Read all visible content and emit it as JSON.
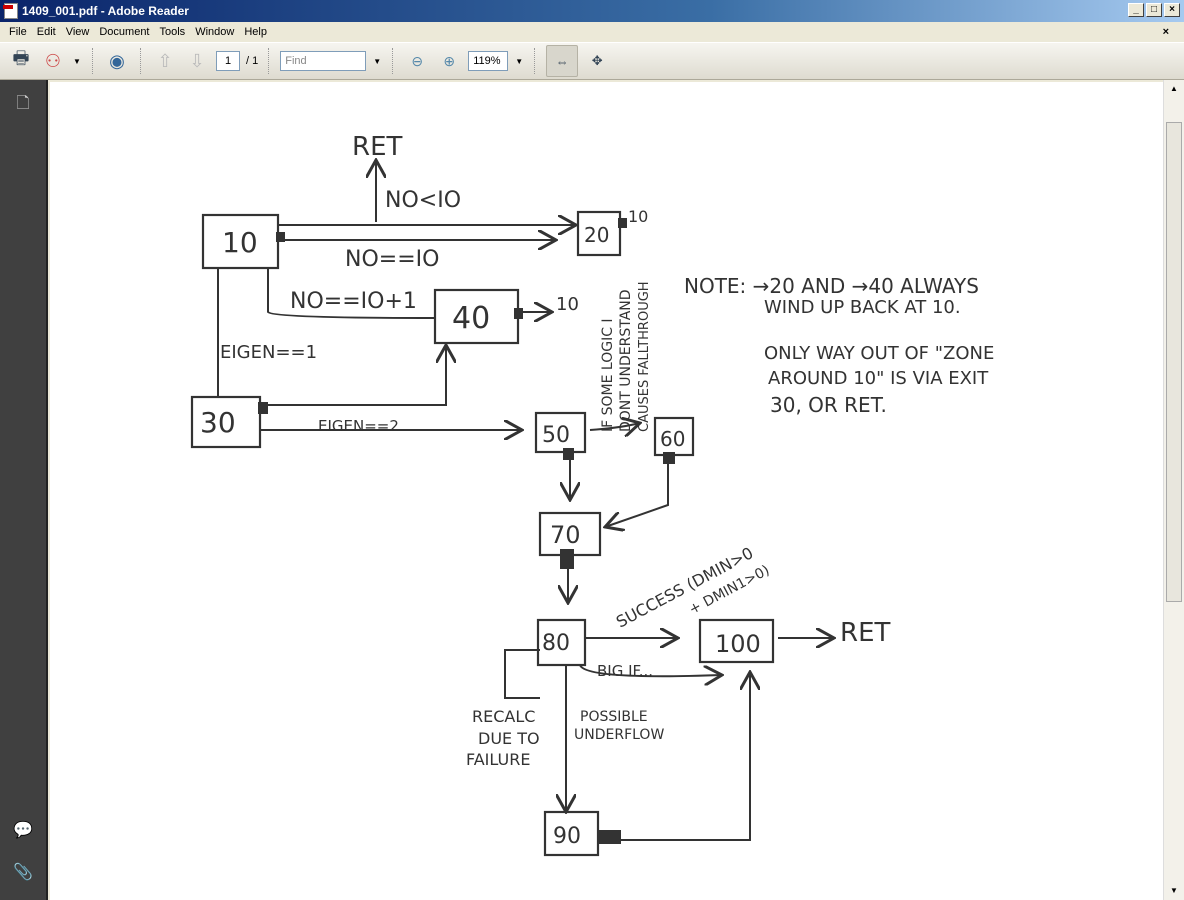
{
  "window": {
    "title": "1409_001.pdf - Adobe Reader",
    "controls": [
      "_",
      "□",
      "×"
    ]
  },
  "menu": {
    "items": [
      "File",
      "Edit",
      "View",
      "Document",
      "Tools",
      "Window",
      "Help"
    ],
    "close_doc": "×"
  },
  "toolbar": {
    "page_current": "1",
    "page_total": "/ 1",
    "find_placeholder": "Find",
    "zoom": "119%"
  },
  "document": {
    "nodes": [
      "10",
      "20",
      "40",
      "30",
      "50",
      "60",
      "70",
      "80",
      "100",
      "90"
    ],
    "labels": {
      "ret_top": "RET",
      "no_lt_io": "NO<IO",
      "no_eq_io": "NO==IO",
      "no_eq_io1": "NO==IO+1",
      "to10_a": "10",
      "to10_b": "10",
      "eigen1": "EIGEN==1",
      "eigen2": "EIGEN==2",
      "fallthrough": [
        "IF SOME LOGIC I",
        "DONT UNDERSTAND",
        "CAUSES FALLTHROUGH"
      ],
      "success": "SUCCESS (DMIN>0",
      "success2": "+ DMIN1>0)",
      "ret_bottom": "RET",
      "big_if": "BIG IF...",
      "recalc": [
        "RECALC",
        "DUE TO",
        "FAILURE"
      ],
      "underflow": [
        "POSSIBLE",
        "UNDERFLOW"
      ]
    },
    "note": [
      "NOTE: →20 AND →40 ALWAYS",
      "WIND UP BACK AT 10.",
      "ONLY WAY OUT OF \"ZONE",
      "AROUND 10\" IS VIA EXIT",
      "30, OR RET."
    ]
  }
}
